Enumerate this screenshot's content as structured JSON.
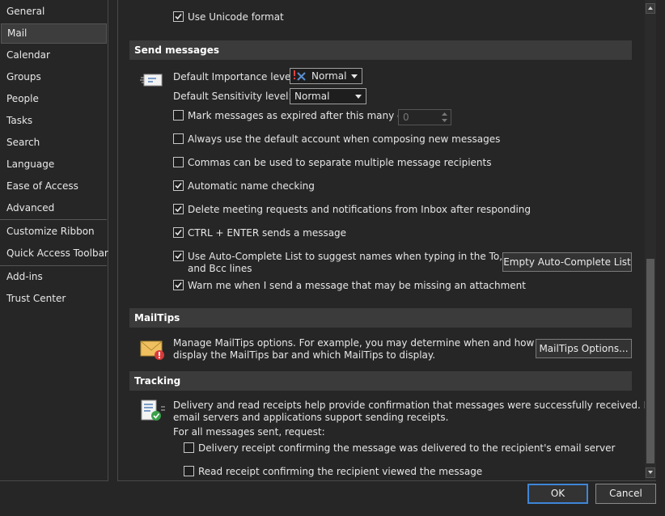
{
  "sidebar": {
    "items": [
      {
        "label": "General"
      },
      {
        "label": "Mail"
      },
      {
        "label": "Calendar"
      },
      {
        "label": "Groups"
      },
      {
        "label": "People"
      },
      {
        "label": "Tasks"
      },
      {
        "label": "Search"
      },
      {
        "label": "Language"
      },
      {
        "label": "Ease of Access"
      },
      {
        "label": "Advanced"
      },
      {
        "label": "Customize Ribbon"
      },
      {
        "label": "Quick Access Toolbar"
      },
      {
        "label": "Add-ins"
      },
      {
        "label": "Trust Center"
      }
    ],
    "selected": "Mail"
  },
  "top": {
    "use_unicode": {
      "label": "Use Unicode format",
      "checked": true
    }
  },
  "send_messages": {
    "header": "Send messages",
    "importance_label": "Default Importance level:",
    "importance_value": "Normal",
    "sensitivity_label": "Default Sensitivity level:",
    "sensitivity_value": "Normal",
    "options": [
      {
        "label": "Mark messages as expired after this many days:",
        "checked": false
      },
      {
        "label": "Always use the default account when composing new messages",
        "checked": false
      },
      {
        "label": "Commas can be used to separate multiple message recipients",
        "checked": false
      },
      {
        "label": "Automatic name checking",
        "checked": true
      },
      {
        "label": "Delete meeting requests and notifications from Inbox after responding",
        "checked": true
      },
      {
        "label": "CTRL + ENTER sends a message",
        "checked": true
      },
      {
        "label": "Use Auto-Complete List to suggest names when typing in the To, Cc,",
        "label_line2": "and Bcc lines",
        "checked": true
      },
      {
        "label": "Warn me when I send a message that may be missing an attachment",
        "checked": true
      }
    ],
    "expire_days_value": "0",
    "empty_autocomplete_button": "Empty Auto-Complete List"
  },
  "mailtips": {
    "header": "MailTips",
    "description_line1": "Manage MailTips options. For example, you may determine when and how to",
    "description_line2": "display the MailTips bar and which MailTips to display.",
    "options_button": "MailTips Options..."
  },
  "tracking": {
    "header": "Tracking",
    "description_line1": "Delivery and read receipts help provide confirmation that messages were successfully received. Not all",
    "description_line2": "email servers and applications support sending receipts.",
    "request_label": "For all messages sent, request:",
    "options": [
      {
        "label": "Delivery receipt confirming the message was delivered to the recipient's email server",
        "checked": false
      },
      {
        "label": "Read receipt confirming the recipient viewed the message",
        "checked": false
      }
    ]
  },
  "footer": {
    "ok_label": "OK",
    "cancel_label": "Cancel"
  },
  "colors": {
    "background": "#262626",
    "section_header": "#3b3b3b",
    "accent": "#3e86d6"
  }
}
